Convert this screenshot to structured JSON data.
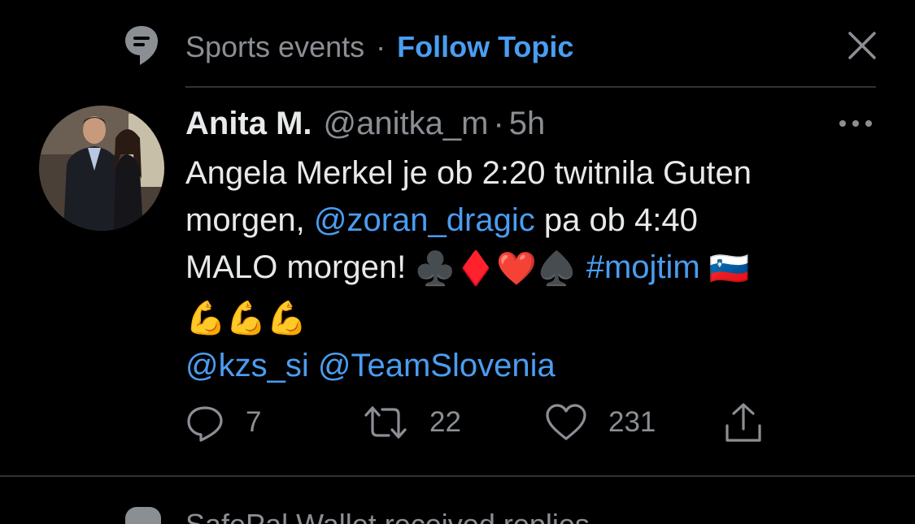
{
  "topic": {
    "name": "Sports events",
    "separator": "·",
    "follow_label": "Follow Topic",
    "icon": "topic-icon",
    "close_icon": "close-icon"
  },
  "tweet": {
    "author_name": "Anita M.",
    "handle": "@anitka_m",
    "separator": "·",
    "time": "5h",
    "more_icon": "more-icon",
    "body": {
      "line1": "Angela Merkel je ob 2:20 twitnila Guten",
      "morgen_prefix": "morgen, ",
      "mention_zoran": "@zoran_dragic",
      "after_mention": " pa ob 4:40",
      "malo": "MALO morgen! ",
      "emoji_suits": [
        "♣️",
        "♦️",
        "❤️",
        "♠️"
      ],
      "hashtag": "#mojtim",
      "flag": "🇸🇮",
      "emoji_muscles": [
        "💪",
        "💪",
        "💪"
      ],
      "mention_kzs": "@kzs_si",
      "mention_team": "@TeamSlovenia"
    },
    "actions": {
      "reply_count": "7",
      "retweet_count": "22",
      "like_count": "231",
      "share_icon": "share-icon"
    }
  },
  "next_item": {
    "text": "SafePal Wallet received replies",
    "icon": "topic-icon"
  },
  "colors": {
    "background": "#000000",
    "accent": "#4a9df0",
    "secondary_text": "#8b8f94",
    "primary_text": "#e7e9ea",
    "divider": "#2f3336"
  }
}
